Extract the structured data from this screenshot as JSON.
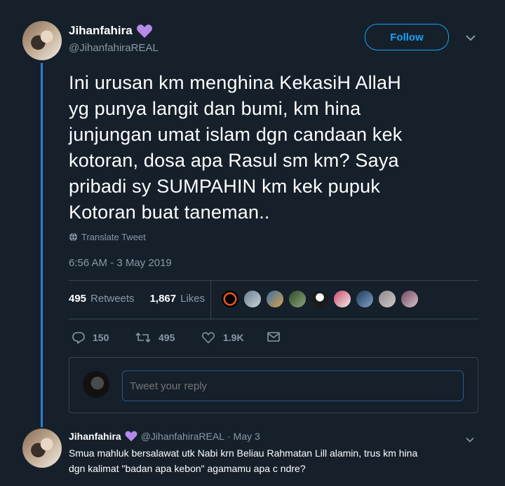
{
  "tweet": {
    "author_name": "Jihanfahira",
    "author_handle": "@JihanfahiraREAL",
    "follow_label": "Follow",
    "text_lines": [
      "Ini urusan km menghina KekasiH AllaH",
      "yg punya langit dan bumi, km hina",
      "junjungan umat islam dgn candaan kek",
      "kotoran, dosa apa Rasul sm km? Saya",
      "pribadi sy SUMPAHIN km kek pupuk",
      "Kotoran buat taneman.."
    ],
    "translate_label": "Translate Tweet",
    "timestamp": "6:56 AM - 3 May 2019",
    "retweets_count": "495",
    "retweets_label": "Retweets",
    "likes_count": "1,867",
    "likes_label": "Likes",
    "actions": {
      "reply_count": "150",
      "retweet_count": "495",
      "like_count": "1.9K"
    }
  },
  "reply_compose": {
    "placeholder": "Tweet your reply"
  },
  "reply_tweet": {
    "author_name": "Jihanfahira",
    "author_handle": "@JihanfahiraREAL",
    "date": "May 3",
    "separator": "·",
    "text_lines": [
      "Smua mahluk bersalawat utk Nabi krn Beliau Rahmatan Lill alamin, trus km hina",
      "dgn kalimat \"badan apa kebon\" agamamu apa c ndre?"
    ]
  },
  "colors": {
    "background": "#15202b",
    "accent": "#1da1f2",
    "verified_heart": "#b38ae8",
    "muted": "#8899a6"
  },
  "icons": [
    "purple-heart-icon",
    "chevron-down-icon",
    "globe-icon",
    "reply-icon",
    "retweet-icon",
    "like-icon",
    "dm-icon"
  ]
}
